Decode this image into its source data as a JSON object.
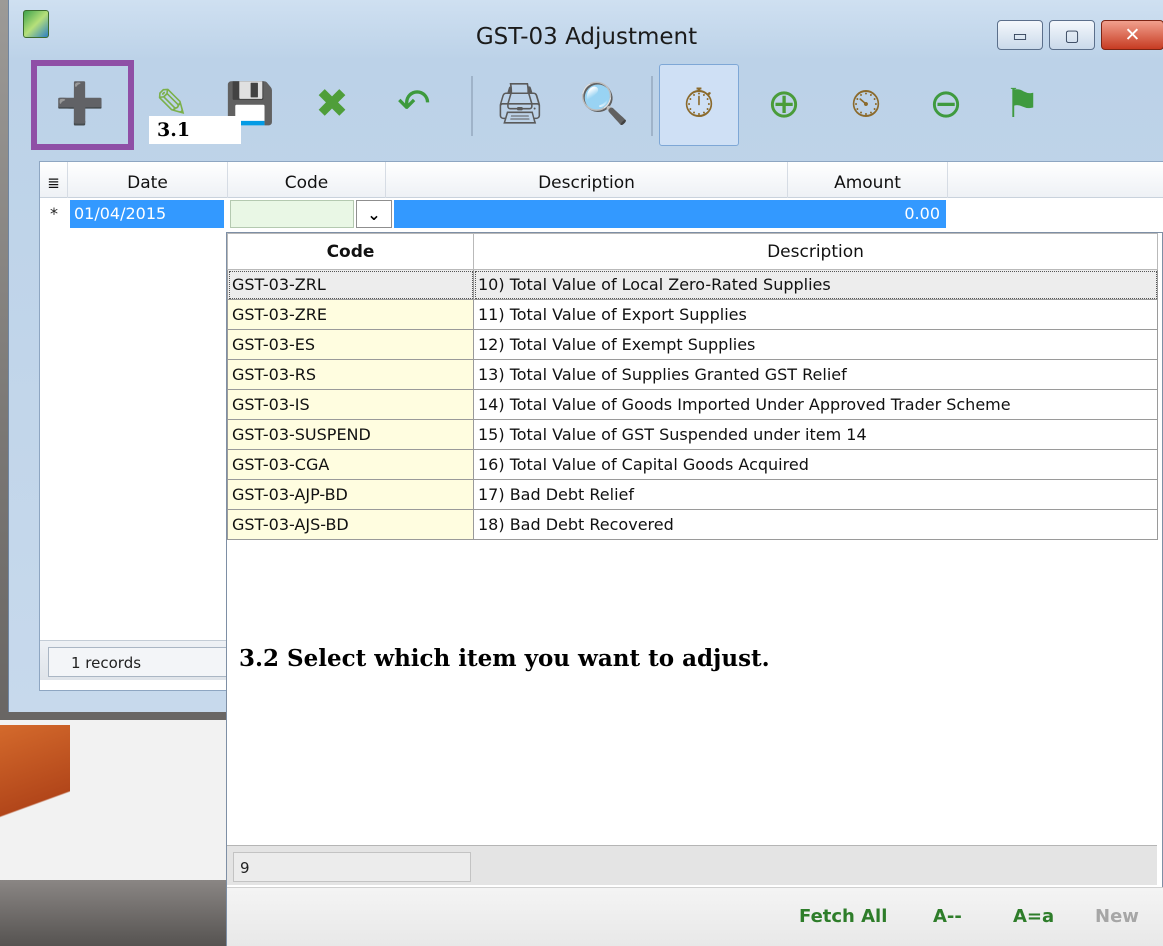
{
  "window": {
    "title": "GST-03 Adjustment",
    "controls": {
      "minimize": "▭",
      "maximize": "▢",
      "close": "✕"
    }
  },
  "toolbar": {
    "icons": [
      {
        "name": "new-record-icon",
        "glyph": "➕"
      },
      {
        "name": "edit-record-icon",
        "glyph": "✎"
      },
      {
        "name": "save-icon",
        "glyph": "💾"
      },
      {
        "name": "delete-record-icon",
        "glyph": "✖"
      },
      {
        "name": "undo-icon",
        "glyph": "↶"
      },
      {
        "name": "print-icon",
        "glyph": "🖨"
      },
      {
        "name": "preview-icon",
        "glyph": "🔍"
      },
      {
        "name": "filter-icon",
        "glyph": "⏱"
      },
      {
        "name": "add-filter-icon",
        "glyph": "⊕"
      },
      {
        "name": "clear-filter-icon",
        "glyph": "⏲"
      },
      {
        "name": "remove-filter-icon",
        "glyph": "⊖"
      },
      {
        "name": "flag-icon",
        "glyph": "⚑"
      }
    ],
    "step_label": "3.1"
  },
  "grid": {
    "columns": [
      "Date",
      "Code",
      "Description",
      "Amount"
    ],
    "row_indicator_header": "≣",
    "new_row": {
      "marker": "*",
      "date": "01/04/2015",
      "code": "",
      "description": "",
      "amount": "0.00"
    },
    "dropdown_arrow": "⌄",
    "footer": {
      "records": "1 records"
    }
  },
  "lookup": {
    "columns": [
      "Code",
      "Description"
    ],
    "rows": [
      {
        "code": "GST-03-ZRL",
        "description": "10) Total Value of Local Zero-Rated Supplies"
      },
      {
        "code": "GST-03-ZRE",
        "description": "11) Total Value of Export Supplies"
      },
      {
        "code": "GST-03-ES",
        "description": "12) Total Value of Exempt Supplies"
      },
      {
        "code": "GST-03-RS",
        "description": "13) Total Value of Supplies Granted GST Relief"
      },
      {
        "code": "GST-03-IS",
        "description": "14) Total Value of Goods Imported Under Approved Trader Scheme"
      },
      {
        "code": "GST-03-SUSPEND",
        "description": "15) Total Value of GST Suspended under item 14"
      },
      {
        "code": "GST-03-CGA",
        "description": "16) Total Value of Capital Goods Acquired"
      },
      {
        "code": "GST-03-AJP-BD",
        "description": "17) Bad Debt Relief"
      },
      {
        "code": "GST-03-AJS-BD",
        "description": "18) Bad Debt Recovered"
      }
    ],
    "instruction": "3.2 Select which item you want to adjust.",
    "count": "9",
    "links": {
      "fetch_all": "Fetch All",
      "sort_az": "A--",
      "case": "A=a",
      "new": "New"
    }
  },
  "colors": {
    "selection_blue": "#3399ff",
    "highlight_purple": "#8f4fa6",
    "code_cell_yellow": "#fffde0",
    "link_green": "#2e7d2a"
  }
}
